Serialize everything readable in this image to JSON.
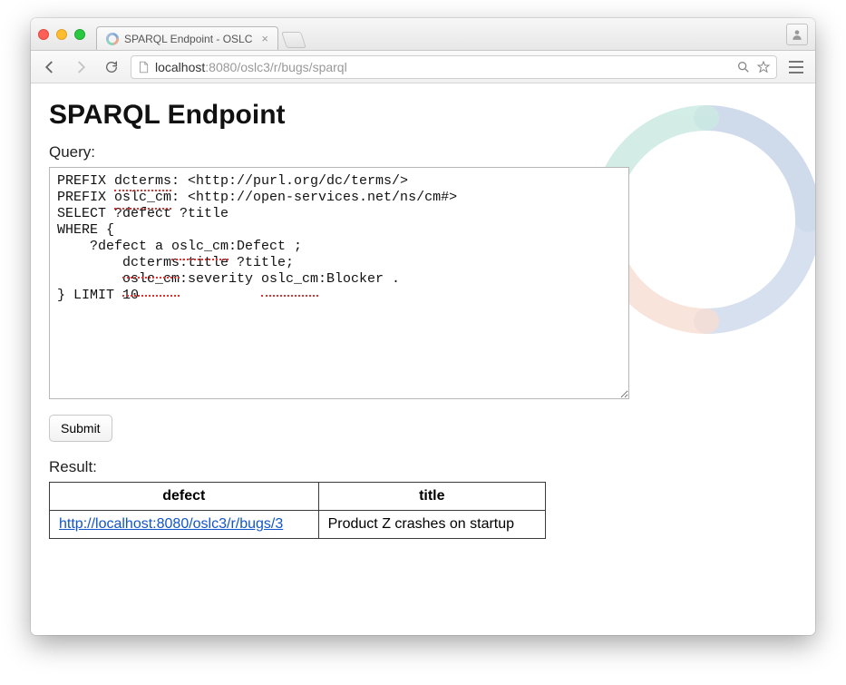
{
  "browser": {
    "tab_title": "SPARQL Endpoint - OSLC",
    "url_host": "localhost",
    "url_port": ":8080",
    "url_path": "/oslc3/r/bugs/sparql"
  },
  "page": {
    "heading": "SPARQL Endpoint",
    "query_label": "Query:",
    "query_text": "PREFIX dcterms: <http://purl.org/dc/terms/>\nPREFIX oslc_cm: <http://open-services.net/ns/cm#>\nSELECT ?defect ?title\nWHERE {\n    ?defect a oslc_cm:Defect ;\n        dcterms:title ?title;\n        oslc_cm:severity oslc_cm:Blocker .\n} LIMIT 10",
    "submit_label": "Submit",
    "result_label": "Result:",
    "result_headers": [
      "defect",
      "title"
    ],
    "result_rows": [
      {
        "defect_url": "http://localhost:8080/oslc3/r/bugs/3",
        "title": "Product Z crashes on startup"
      }
    ]
  },
  "colors": {
    "logo_blue": "#b0c4de",
    "logo_teal": "#a9dcd0",
    "logo_orange": "#f3c7b7"
  }
}
